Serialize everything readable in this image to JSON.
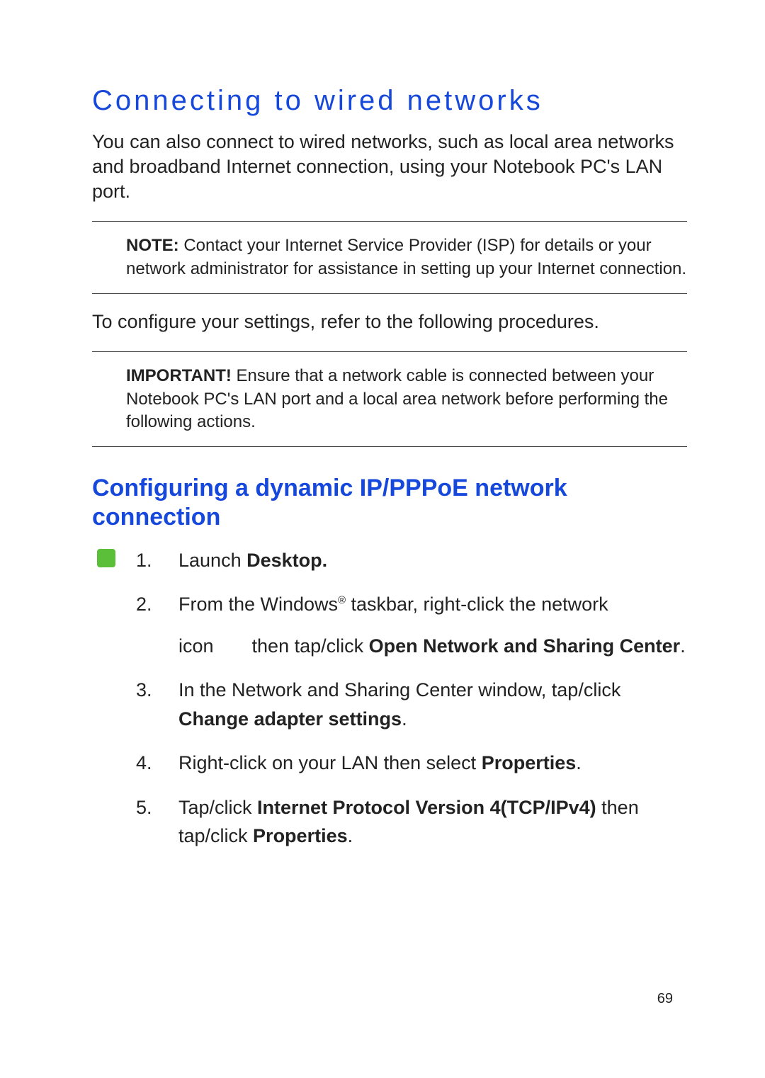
{
  "title": "Connecting to wired networks",
  "intro": "You can also connect to wired networks, such as local area networks and broadband Internet connection, using your Notebook PC's LAN port.",
  "note": {
    "label": "NOTE:",
    "text": " Contact your Internet Service Provider (ISP) for details or your network administrator for assistance in setting up your Internet connection."
  },
  "configure_line": "To configure your settings, refer to the following procedures.",
  "important": {
    "label": "IMPORTANT!",
    "text": "  Ensure that a network cable is connected between your Notebook PC's LAN port and a local area network before performing the following actions."
  },
  "subsection": "Configuring a dynamic IP/PPPoE network connection",
  "steps": {
    "s1a": "Launch ",
    "s1b": "Desktop.",
    "s2a": "From the Windows",
    "s2reg": "®",
    "s2b": " taskbar, right-click the network",
    "s2c": "icon",
    "s2d": "then tap/click ",
    "s2e": "Open Network and Sharing Center",
    "s2f": ".",
    "s3a": "In the Network and Sharing Center window, tap/click ",
    "s3b": "Change adapter settings",
    "s3c": ".",
    "s4a": "Right-click on your LAN then select ",
    "s4b": "Properties",
    "s4c": ".",
    "s5a": "Tap/click ",
    "s5b": "Internet Protocol Version 4(TCP/IPv4)",
    "s5c": " then tap/click ",
    "s5d": "Properties",
    "s5e": "."
  },
  "page_number": "69"
}
